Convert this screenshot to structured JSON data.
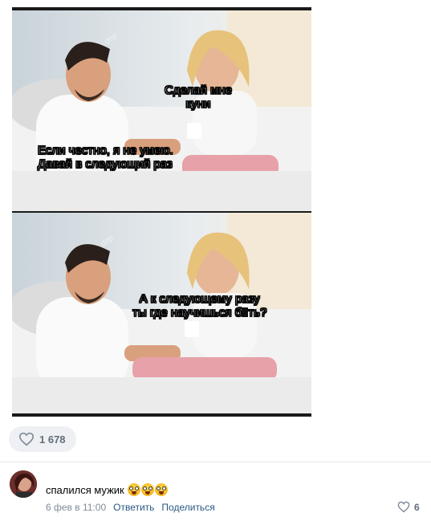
{
  "post": {
    "captions": {
      "top_panel_woman": [
        "Сделай мне",
        "куни"
      ],
      "top_panel_man": [
        "Если честно, я не умею.",
        "Давай в следующий раз"
      ],
      "bottom_panel_woman_line1": "А к следующему разу",
      "bottom_panel_woman_line2_before": "ты где научишься б",
      "bottom_panel_woman_line2_after": "ть?"
    },
    "likes": "1 678"
  },
  "comment": {
    "text": "спалился мужик",
    "emoji_icons": [
      "grinning-face-icon",
      "grinning-face-icon",
      "grinning-face-icon"
    ],
    "date": "6 фев в 11:00",
    "reply_label": "Ответить",
    "share_label": "Поделиться",
    "likes": "6"
  },
  "colors": {
    "link": "#2a5885",
    "meta": "#818c99",
    "count": "#626d7a",
    "pill_bg": "#eef0f3",
    "divider": "#e7e8ec"
  }
}
